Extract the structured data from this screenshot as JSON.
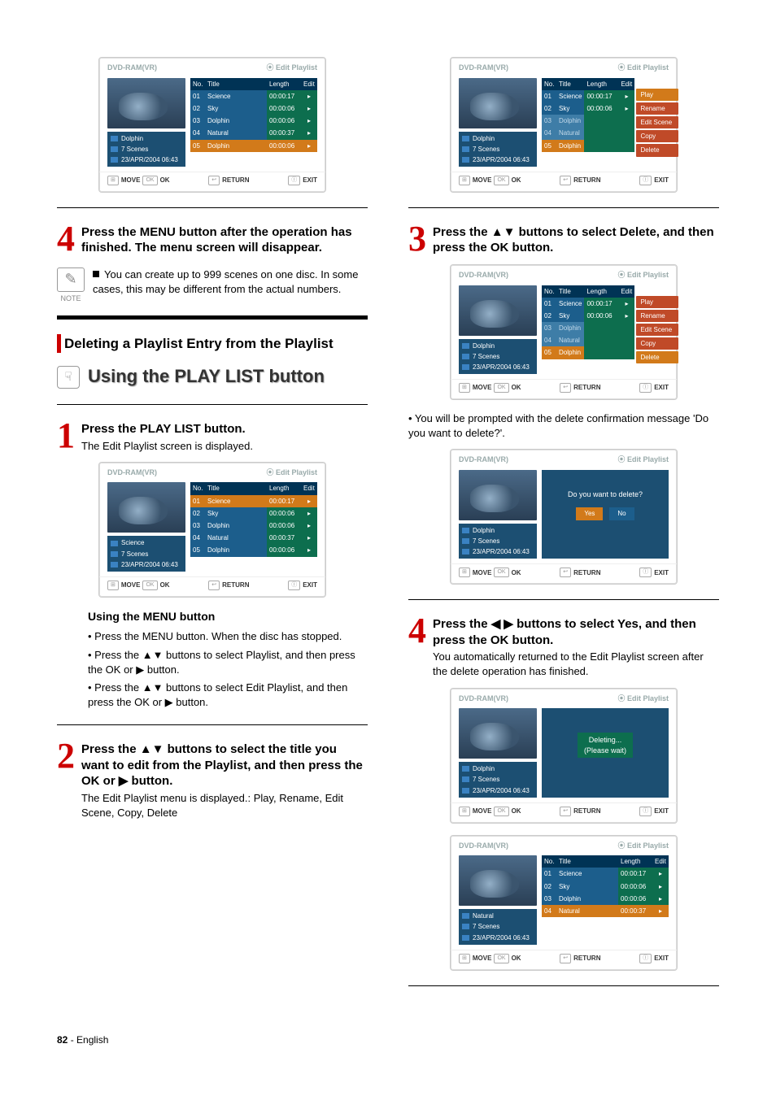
{
  "left": {
    "step4": {
      "num": "4",
      "title": "Press the MENU button after the operation has finished. The menu screen will disappear."
    },
    "note": {
      "label": "NOTE",
      "text": "You can create up to 999 scenes on one disc. In some cases, this may be different from the actual numbers."
    },
    "sectionHead": "Deleting a Playlist Entry from the Playlist",
    "playlistBtn": "Using the PLAY LIST button",
    "step1": {
      "num": "1",
      "title": "Press the PLAY LIST button.",
      "sub": "The Edit Playlist screen is displayed."
    },
    "menuHead": "Using the MENU button",
    "menuBody": {
      "l1": "• Press the MENU button. When the disc has stopped.",
      "l2a": "• Press the ",
      "l2b": " buttons to select Playlist, and then press the OK or ",
      "l2c": " button.",
      "l3a": "• Press the ",
      "l3b": " buttons to select Edit Playlist, and then press the OK or ",
      "l3c": " button."
    },
    "step2": {
      "num": "2",
      "titleA": "Press the ",
      "titleB": " buttons to select the title you want to edit from the Playlist, and then press the OK or ",
      "titleC": " button.",
      "sub": "The Edit Playlist menu is displayed.: Play, Rename, Edit Scene, Copy, Delete"
    }
  },
  "right": {
    "step3": {
      "num": "3",
      "titleA": "Press the ",
      "titleB": " buttons to select Delete, and then press the OK button."
    },
    "confirmNote": "• You will be prompted with the delete confirmation message 'Do you want to delete?'.",
    "step4": {
      "num": "4",
      "titleA": "Press the ",
      "titleB": " buttons to select Yes, and then press the OK button.",
      "sub": "You automatically returned to the Edit Playlist screen after the delete operation has finished."
    }
  },
  "tv": {
    "barLeft": "DVD-RAM(VR)",
    "barRight": "Edit Playlist",
    "clock": "⦿",
    "headNo": "No.",
    "headTitle": "Title",
    "headLength": "Length",
    "headEdit": "Edit",
    "footer": {
      "move": "MOVE",
      "ok": "OK",
      "return": "RETURN",
      "exit": "EXIT"
    },
    "popup": {
      "play": "Play",
      "rename": "Rename",
      "editScene": "Edit Scene",
      "copy": "Copy",
      "delete": "Delete"
    },
    "confirm": {
      "msg": "Do you want to delete?",
      "yes": "Yes",
      "no": "No"
    },
    "deleting": {
      "l1": "Deleting...",
      "l2": "(Please wait)"
    },
    "screens": {
      "a": {
        "metaName": "Dolphin",
        "metaScenes": "7 Scenes",
        "metaDate": "23/APR/2004 06:43",
        "rows": [
          {
            "no": "01",
            "title": "Science",
            "len": "00:00:17"
          },
          {
            "no": "02",
            "title": "Sky",
            "len": "00:00:06"
          },
          {
            "no": "03",
            "title": "Dolphin",
            "len": "00:00:06"
          },
          {
            "no": "04",
            "title": "Natural",
            "len": "00:00:37"
          },
          {
            "no": "05",
            "title": "Dolphin",
            "len": "00:00:06"
          }
        ],
        "selIndex": 4
      },
      "b": {
        "metaName": "Science",
        "metaScenes": "7 Scenes",
        "metaDate": "23/APR/2004 06:43",
        "rows": [
          {
            "no": "01",
            "title": "Science",
            "len": "00:00:17"
          },
          {
            "no": "02",
            "title": "Sky",
            "len": "00:00:06"
          },
          {
            "no": "03",
            "title": "Dolphin",
            "len": "00:00:06"
          },
          {
            "no": "04",
            "title": "Natural",
            "len": "00:00:37"
          },
          {
            "no": "05",
            "title": "Dolphin",
            "len": "00:00:06"
          }
        ],
        "selIndex": 0
      },
      "c": {
        "metaName": "Dolphin",
        "metaScenes": "7 Scenes",
        "metaDate": "23/APR/2004 06:43",
        "rows": [
          {
            "no": "01",
            "title": "Science",
            "len": "00:00:17"
          },
          {
            "no": "02",
            "title": "Sky",
            "len": "00:00:06"
          },
          {
            "no": "03",
            "title": "Dolphin"
          },
          {
            "no": "04",
            "title": "Natural"
          },
          {
            "no": "05",
            "title": "Dolphin"
          }
        ],
        "popupSel": 0
      },
      "d": {
        "metaName": "Dolphin",
        "metaScenes": "7 Scenes",
        "metaDate": "23/APR/2004 06:43",
        "rows": [
          {
            "no": "01",
            "title": "Science",
            "len": "00:00:17"
          },
          {
            "no": "02",
            "title": "Sky",
            "len": "00:00:06"
          },
          {
            "no": "03",
            "title": "Dolphin"
          },
          {
            "no": "04",
            "title": "Natural"
          },
          {
            "no": "05",
            "title": "Dolphin"
          }
        ],
        "popupSel": 4
      },
      "e": {
        "metaName": "Dolphin",
        "metaScenes": "7 Scenes",
        "metaDate": "23/APR/2004 06:43"
      },
      "f": {
        "metaName": "Dolphin",
        "metaScenes": "7 Scenes",
        "metaDate": "23/APR/2004 06:43"
      },
      "g": {
        "metaName": "Natural",
        "metaScenes": "7 Scenes",
        "metaDate": "23/APR/2004 06:43",
        "rows": [
          {
            "no": "01",
            "title": "Science",
            "len": "00:00:17"
          },
          {
            "no": "02",
            "title": "Sky",
            "len": "00:00:06"
          },
          {
            "no": "03",
            "title": "Dolphin",
            "len": "00:00:06"
          },
          {
            "no": "04",
            "title": "Natural",
            "len": "00:00:37"
          }
        ],
        "selIndex": 3
      }
    }
  },
  "footer": {
    "page": "82",
    "lang": "English"
  }
}
